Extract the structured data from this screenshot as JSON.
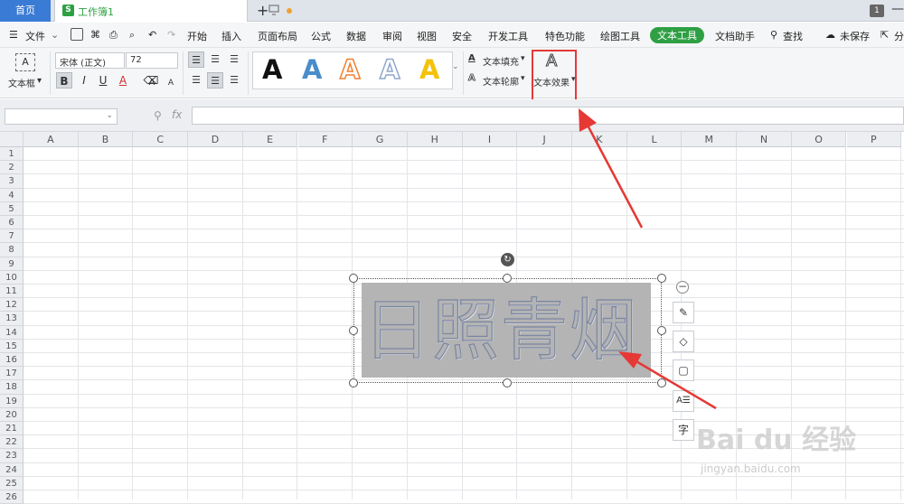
{
  "tabs": {
    "home": "首页",
    "document": "工作簿1",
    "new_tab": "+",
    "window_count": "1"
  },
  "menu": {
    "file": "文件",
    "items": [
      "开始",
      "插入",
      "页面布局",
      "公式",
      "数据",
      "审阅",
      "视图",
      "安全",
      "开发工具",
      "特色功能",
      "绘图工具",
      "文本工具",
      "文档助手"
    ],
    "active": "文本工具",
    "search": "查找",
    "unsaved": "未保存",
    "share": "分"
  },
  "ribbon": {
    "textbox_label": "文本框",
    "font_name": "宋体 (正文)",
    "font_size": "72",
    "bold": "B",
    "italic": "I",
    "underline": "U",
    "font_color": "A",
    "text_fill": "文本填充",
    "text_outline": "文本轮廓",
    "text_effect": "文本效果",
    "gallery": [
      {
        "glyph": "A",
        "color": "#111111",
        "style": "solid"
      },
      {
        "glyph": "A",
        "color": "#4a8ccc",
        "style": "solid"
      },
      {
        "glyph": "A",
        "color": "#f08030",
        "style": "outline"
      },
      {
        "glyph": "A",
        "color": "#8fa8cc",
        "style": "outline"
      },
      {
        "glyph": "A",
        "color": "#f4c20d",
        "style": "solid"
      }
    ]
  },
  "formula_bar": {
    "fx_label": "fx"
  },
  "columns": [
    "A",
    "B",
    "C",
    "D",
    "E",
    "F",
    "G",
    "H",
    "I",
    "J",
    "K",
    "L",
    "M",
    "N",
    "O",
    "P"
  ],
  "rows": [
    "1",
    "2",
    "3",
    "4",
    "5",
    "6",
    "7",
    "8",
    "9",
    "10",
    "11",
    "12",
    "13",
    "14",
    "15",
    "16",
    "17",
    "18",
    "19",
    "20",
    "21",
    "22",
    "23",
    "24",
    "25",
    "26"
  ],
  "art_text": "日照青烟",
  "side_tools": {
    "collapse": "−",
    "char": "字"
  },
  "watermark": {
    "brand": "Bai du 经验",
    "url": "jingyan.baidu.com"
  },
  "colors": {
    "accent": "#2ea043",
    "home_tab": "#3a7bd5",
    "highlight": "#e53935"
  }
}
